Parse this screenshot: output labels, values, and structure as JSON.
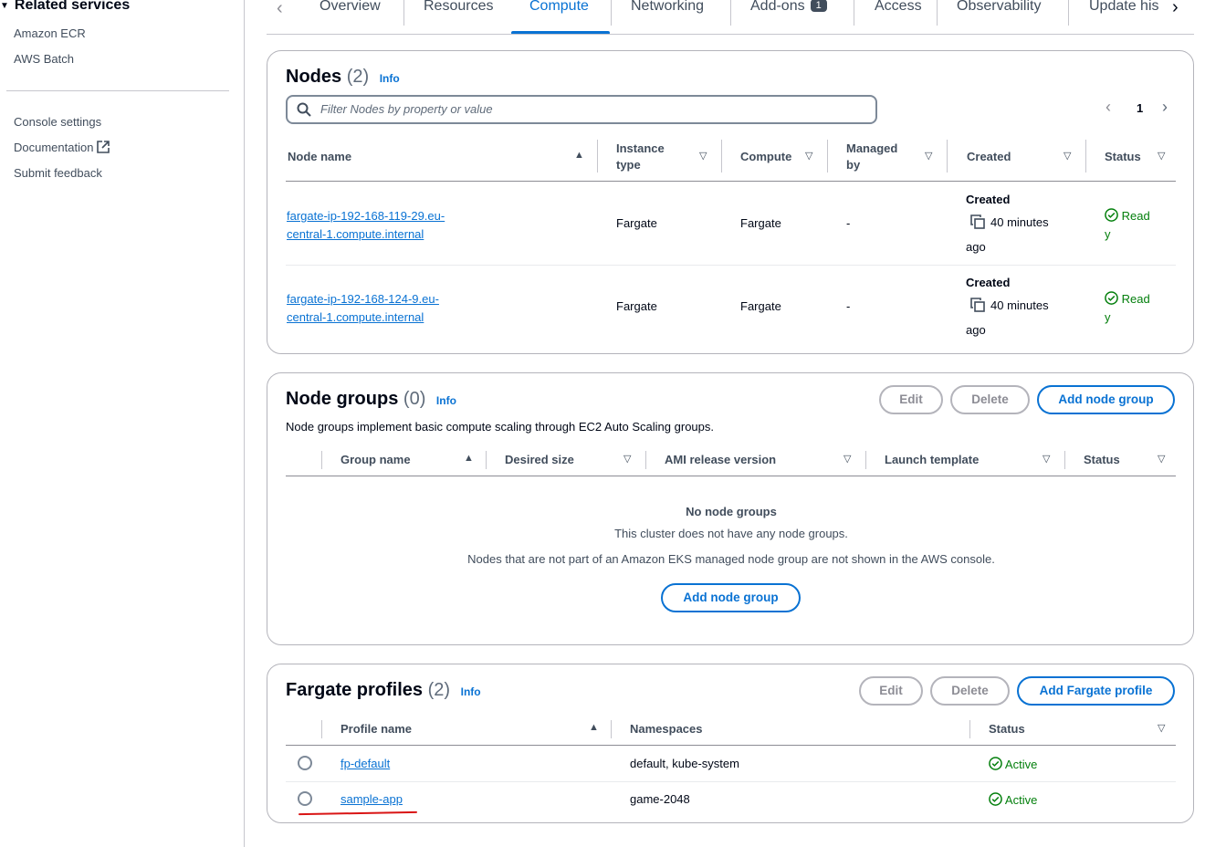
{
  "sidebar": {
    "heading": "Related services",
    "related": [
      "Amazon ECR",
      "AWS Batch"
    ],
    "links": [
      "Console settings",
      "Documentation",
      "Submit feedback"
    ]
  },
  "tabs": {
    "items": [
      "Overview",
      "Resources",
      "Compute",
      "Networking",
      "Add-ons",
      "Access",
      "Observability",
      "Update his"
    ],
    "active": "Compute",
    "addons_badge": "1"
  },
  "nodes": {
    "title": "Nodes",
    "count": "(2)",
    "info": "Info",
    "filter_placeholder": "Filter Nodes by property or value",
    "page": "1",
    "columns": [
      "Node name",
      "Instance type",
      "Compute",
      "Managed by",
      "Created",
      "Status"
    ],
    "rows": [
      {
        "name_line1": "fargate-ip-192-168-119-29.eu-",
        "name_line2": "central-1.compute.internal",
        "instance_type": "Fargate",
        "compute": "Fargate",
        "managed_by": "-",
        "created_label": "Created",
        "created_value": "40 minutes",
        "created_suffix": "ago",
        "status_line1": "Read",
        "status_line2": "y"
      },
      {
        "name_line1": "fargate-ip-192-168-124-9.eu-",
        "name_line2": "central-1.compute.internal",
        "instance_type": "Fargate",
        "compute": "Fargate",
        "managed_by": "-",
        "created_label": "Created",
        "created_value": "40 minutes",
        "created_suffix": "ago",
        "status_line1": "Read",
        "status_line2": "y"
      }
    ]
  },
  "node_groups": {
    "title": "Node groups",
    "count": "(0)",
    "info": "Info",
    "description": "Node groups implement basic compute scaling through EC2 Auto Scaling groups.",
    "buttons": {
      "edit": "Edit",
      "delete": "Delete",
      "add": "Add node group"
    },
    "columns": [
      "Group name",
      "Desired size",
      "AMI release version",
      "Launch template",
      "Status"
    ],
    "empty_title": "No node groups",
    "empty_line1": "This cluster does not have any node groups.",
    "empty_line2": "Nodes that are not part of an Amazon EKS managed node group are not shown in the AWS console.",
    "empty_button": "Add node group"
  },
  "fargate": {
    "title": "Fargate profiles",
    "count": "(2)",
    "info": "Info",
    "buttons": {
      "edit": "Edit",
      "delete": "Delete",
      "add": "Add Fargate profile"
    },
    "columns": [
      "Profile name",
      "Namespaces",
      "Status"
    ],
    "rows": [
      {
        "name": "fp-default",
        "namespaces": "default, kube-system",
        "status": "Active"
      },
      {
        "name": "sample-app",
        "namespaces": "game-2048",
        "status": "Active"
      }
    ]
  },
  "colors": {
    "accent": "#0972d3",
    "success": "#037f0c",
    "annotation": "#d91515"
  }
}
